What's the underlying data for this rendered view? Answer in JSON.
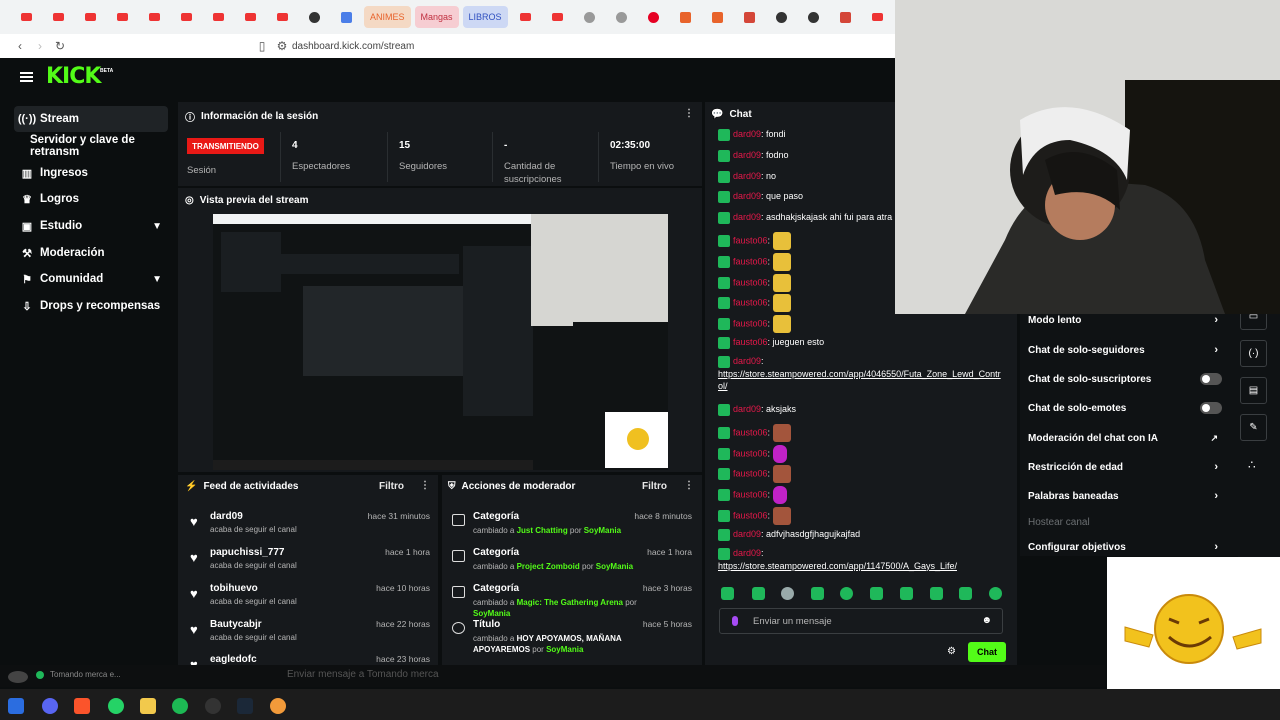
{
  "browser": {
    "bookmarks": [
      {
        "label": "ANIMES",
        "color": "#f4d9c4",
        "text": "#e8632b"
      },
      {
        "label": "Mangas",
        "color": "#f6cdd2",
        "text": "#c03040"
      },
      {
        "label": "LIBROS",
        "color": "#cdd8f4",
        "text": "#3050c0"
      }
    ],
    "url": "dashboard.kick.com/stream"
  },
  "kick": {
    "logo": "KICK",
    "beta": "BETA",
    "sidebar": [
      {
        "label": "Stream",
        "icon": "(·)"
      },
      {
        "label": "Servidor y clave de retransm",
        "icon": ""
      },
      {
        "label": "Ingresos",
        "icon": "▥"
      },
      {
        "label": "Logros",
        "icon": "🏆"
      },
      {
        "label": "Estudio",
        "icon": "▣"
      },
      {
        "label": "Moderación",
        "icon": "🔨"
      },
      {
        "label": "Comunidad",
        "icon": "⚑"
      },
      {
        "label": "Drops y recompensas",
        "icon": "⬇"
      }
    ]
  },
  "session": {
    "title": "Información de la sesión",
    "status": "TRANSMITIENDO",
    "status_label": "Sesión",
    "stats": [
      {
        "value": "4",
        "label": "Espectadores"
      },
      {
        "value": "15",
        "label": "Seguidores"
      },
      {
        "value": "-",
        "label": "Cantidad de suscripciones"
      },
      {
        "value": "02:35:00",
        "label": "Tiempo en vivo"
      }
    ]
  },
  "preview": {
    "title": "Vista previa del stream"
  },
  "feed": {
    "title": "Feed de actividades",
    "filter": "Filtro",
    "items": [
      {
        "name": "dard09",
        "sub": "acaba de seguir el canal",
        "time": "hace 31 minutos"
      },
      {
        "name": "papuchissi_777",
        "sub": "acaba de seguir el canal",
        "time": "hace 1 hora"
      },
      {
        "name": "tobihuevo",
        "sub": "acaba de seguir el canal",
        "time": "hace 10 horas"
      },
      {
        "name": "Bautycabjr",
        "sub": "acaba de seguir el canal",
        "time": "hace 22 horas"
      },
      {
        "name": "eagledofc",
        "sub": "",
        "time": "hace 23 horas"
      }
    ]
  },
  "modactions": {
    "title": "Acciones de moderador",
    "filter": "Filtro",
    "items": [
      {
        "title": "Categoría",
        "pre": "cambiado a ",
        "value": "Just Chatting",
        "by": " por ",
        "user": "SoyMania",
        "time": "hace 8 minutos"
      },
      {
        "title": "Categoría",
        "pre": "cambiado a ",
        "value": "Project Zomboid",
        "by": " por ",
        "user": "SoyMania",
        "time": "hace 1 hora"
      },
      {
        "title": "Categoría",
        "pre": "cambiado a ",
        "value": "Magic: The Gathering Arena",
        "by": " por ",
        "user": "SoyMania",
        "time": "hace 3 horas"
      },
      {
        "title": "Título",
        "pre": "cambiado a ",
        "value": "HOY APOYAMOS, MAÑANA APOYAREMOS",
        "by": " por ",
        "user": "SoyMania",
        "time": "hace 5 horas"
      }
    ]
  },
  "chat": {
    "title": "Chat",
    "messages": [
      {
        "user": "dard09",
        "text": ": fondi"
      },
      {
        "user": "dard09",
        "text": ": fodno"
      },
      {
        "user": "dard09",
        "text": ": no"
      },
      {
        "user": "dard09",
        "text": ": que paso"
      },
      {
        "user": "dard09",
        "text": ": asdhakjskajask ahi fui para atra"
      },
      {
        "user": "fausto06",
        "text": ": ",
        "emote": "cow"
      },
      {
        "user": "fausto06",
        "text": ": ",
        "emote": "cow"
      },
      {
        "user": "fausto06",
        "text": ": ",
        "emote": "cow"
      },
      {
        "user": "fausto06",
        "text": ": ",
        "emote": "cow"
      },
      {
        "user": "fausto06",
        "text": ": ",
        "emote": "cow"
      },
      {
        "user": "fausto06",
        "text": ": jueguen esto"
      },
      {
        "user": "dard09",
        "text": ":",
        "link": "https://store.steampowered.com/app/4046550/Futa_Zone_Lewd_Control/"
      },
      {
        "user": "dard09",
        "text": ": aksjaks"
      },
      {
        "user": "fausto06",
        "text": ": ",
        "emote": "face"
      },
      {
        "user": "fausto06",
        "text": ": ",
        "emote": "pink"
      },
      {
        "user": "fausto06",
        "text": ": ",
        "emote": "face"
      },
      {
        "user": "fausto06",
        "text": ": ",
        "emote": "pink"
      },
      {
        "user": "fausto06",
        "text": ": ",
        "emote": "face"
      },
      {
        "user": "dard09",
        "text": ": adfvjhasdgfjhagujkajfad"
      },
      {
        "user": "dard09",
        "text": ":",
        "link": "https://store.steampowered.com/app/1147500/A_Gays_Life/"
      }
    ],
    "input_placeholder": "Enviar un mensaje",
    "send": "Chat"
  },
  "chat_settings": [
    {
      "label": "Modo lento",
      "control": "chevron"
    },
    {
      "label": "Chat de solo-seguidores",
      "control": "chevron"
    },
    {
      "label": "Chat de solo-suscriptores",
      "control": "toggle"
    },
    {
      "label": "Chat de solo-emotes",
      "control": "toggle"
    },
    {
      "label": "Moderación del chat con IA",
      "control": "external"
    },
    {
      "label": "Restricción de edad",
      "control": "chevron"
    },
    {
      "label": "Palabras baneadas",
      "control": "chevron"
    },
    {
      "label": "Hostear canal",
      "control": "disabled"
    },
    {
      "label": "Configurar objetivos",
      "control": "chevron"
    }
  ],
  "overlay": {
    "tomando": "Tomando merca e...",
    "input": "Enviar mensaje a Tomando merca"
  },
  "colors": {
    "accent": "#53fc18",
    "live": "#e91916",
    "username": "#e5194a",
    "badge": "#1fb85a"
  }
}
